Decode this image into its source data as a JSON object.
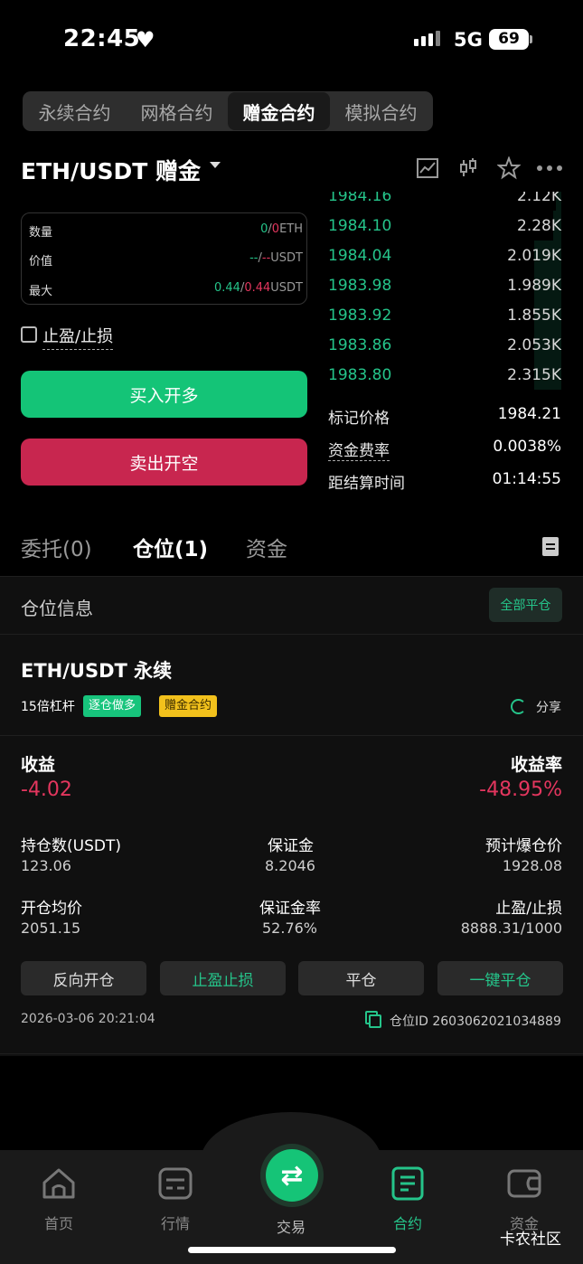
{
  "status_bar": {
    "time": "22:45",
    "network": "5G",
    "battery": "69"
  },
  "contract_tabs": [
    "永续合约",
    "网格合约",
    "赠金合约",
    "模拟合约"
  ],
  "contract_tab_active": 2,
  "pair": "ETH/USDT 赠金",
  "order_form": {
    "rows": [
      {
        "label": "数量",
        "v1": "0",
        "sep": "/",
        "v2": "0",
        "unit": "ETH"
      },
      {
        "label": "价值",
        "v1": "--",
        "sep": "/",
        "v2": "--",
        "unit": "USDT"
      },
      {
        "label": "最大",
        "v1": "0.44",
        "sep": "/",
        "v2": "0.44",
        "unit": "USDT"
      }
    ],
    "tpsl_label": "止盈/止损",
    "buy_label": "买入开多",
    "sell_label": "卖出开空"
  },
  "orderbook": [
    {
      "price": "1984.16",
      "qty": "2.12K",
      "depth": 0.02
    },
    {
      "price": "1984.10",
      "qty": "2.28K",
      "depth": 0.03
    },
    {
      "price": "1984.04",
      "qty": "2.019K",
      "depth": 0.1
    },
    {
      "price": "1983.98",
      "qty": "1.989K",
      "depth": 0.1
    },
    {
      "price": "1983.92",
      "qty": "1.855K",
      "depth": 0.1
    },
    {
      "price": "1983.86",
      "qty": "2.053K",
      "depth": 0.1
    },
    {
      "price": "1983.80",
      "qty": "2.315K",
      "depth": 0.1
    }
  ],
  "market_info": [
    {
      "key": "标记价格",
      "value": "1984.21"
    },
    {
      "key": "资金费率",
      "value": "0.0038%"
    },
    {
      "key": "距结算时间",
      "value": "01:14:55"
    }
  ],
  "position_tabs": [
    "委托(0)",
    "仓位(1)",
    "资金"
  ],
  "position_tab_active": 1,
  "section_title": "仓位信息",
  "close_all_label": "全部平仓",
  "position": {
    "title": "ETH/USDT 永续",
    "leverage": "15倍杠杆",
    "tag_mode": "逐仓做多",
    "tag_bonus": "赠金合约",
    "share_label": "分享",
    "pnl_label": "收益",
    "pnl_value": "-4.02",
    "roe_label": "收益率",
    "roe_value": "-48.95%",
    "fields": [
      {
        "label": "持仓数(USDT)",
        "value": "123.06"
      },
      {
        "label": "保证金",
        "value": "8.2046"
      },
      {
        "label": "预计爆仓价",
        "value": "1928.08"
      },
      {
        "label": "开仓均价",
        "value": "2051.15"
      },
      {
        "label": "保证金率",
        "value": "52.76%"
      },
      {
        "label": "止盈/止损",
        "value": "8888.31/1000"
      }
    ],
    "actions": [
      "反向开仓",
      "止盈止损",
      "平仓",
      "一键平仓"
    ],
    "timestamp": "2026-03-06 20:21:04",
    "position_id": "仓位ID 2603062021034889"
  },
  "bottom_nav": [
    "首页",
    "行情",
    "交易",
    "合约",
    "资金"
  ],
  "bottom_nav_active": 3,
  "watermark": "卡农社区",
  "colors": {
    "green": "#25c48a",
    "red": "#e3365e",
    "buy": "#14c477",
    "sell": "#c8264f",
    "bonus_tag": "#f2c11c"
  }
}
